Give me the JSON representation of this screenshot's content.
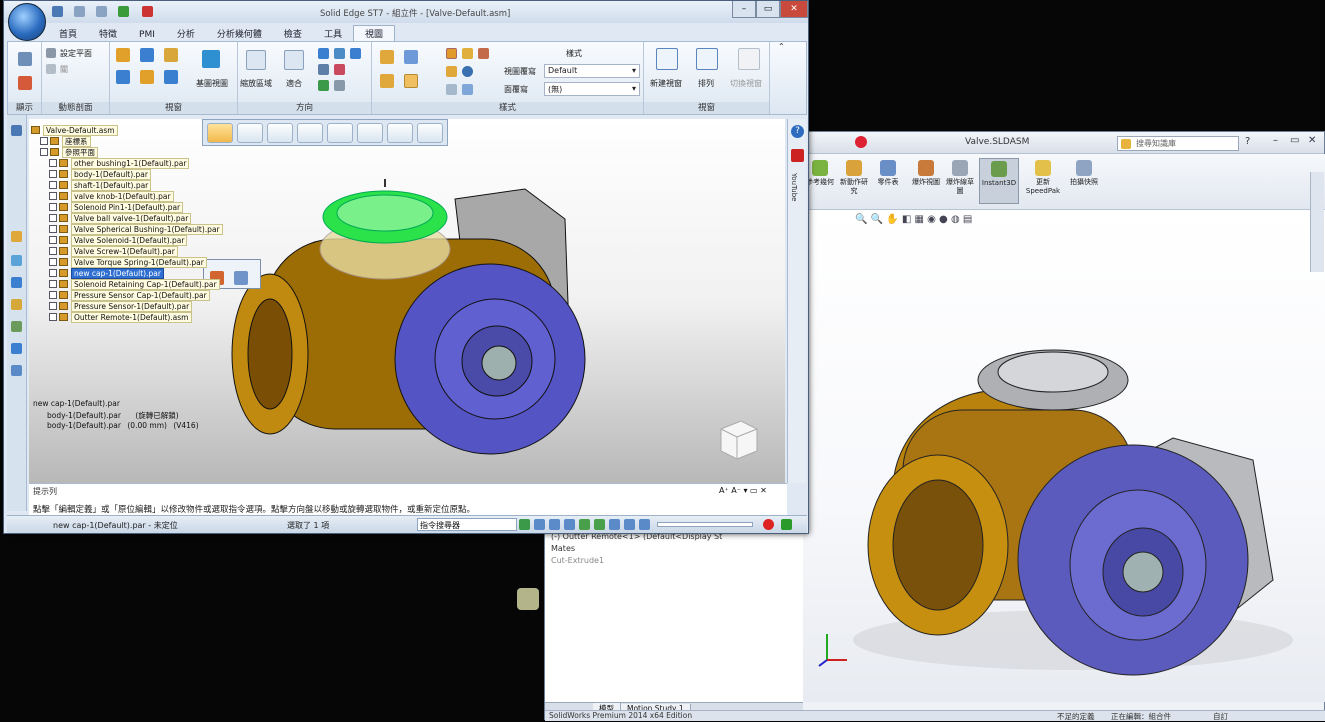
{
  "solidedge": {
    "title": "Solid Edge ST7 - 組立件 - [Valve-Default.asm]",
    "tabs": [
      "首頁",
      "特徵",
      "PMI",
      "分析",
      "分析幾何體",
      "檢查",
      "工具",
      "視圖"
    ],
    "active_tab": "視圖",
    "ribbon": {
      "show_label": "顯示",
      "dynamic_section_label": "動態剖面",
      "set_plane": "設定平面",
      "close": "關",
      "views_label": "視窗",
      "base_view": "基圖視圖",
      "zoom_area": "縮放區域",
      "fit": "適合",
      "orient_label": "方向",
      "view_style": "視圖覆寫",
      "surface_view": "面覆寫",
      "style": "樣式",
      "style_value": "Default",
      "style_none": "(無)",
      "style_group_label": "樣式",
      "new_window": "新建視窗",
      "arrange": "排列",
      "switch_window": "切換視窗",
      "window_group_label": "視窗"
    },
    "pathfinder": [
      {
        "label": "Valve-Default.asm",
        "indent": 0
      },
      {
        "label": "座標系",
        "indent": 1
      },
      {
        "label": "參照平面",
        "indent": 1
      },
      {
        "label": "other bushing1-1(Default).par",
        "indent": 2
      },
      {
        "label": "body-1(Default).par",
        "indent": 2
      },
      {
        "label": "shaft-1(Default).par",
        "indent": 2
      },
      {
        "label": "valve knob-1(Default).par",
        "indent": 2
      },
      {
        "label": "Solenoid Pin1-1(Default).par",
        "indent": 2
      },
      {
        "label": "Valve ball valve-1(Default).par",
        "indent": 2
      },
      {
        "label": "Valve Spherical Bushing-1(Default).par",
        "indent": 2
      },
      {
        "label": "Valve Solenoid-1(Default).par",
        "indent": 2
      },
      {
        "label": "Valve Screw-1(Default).par",
        "indent": 2
      },
      {
        "label": "Valve Torque Spring-1(Default).par",
        "indent": 2
      },
      {
        "label": "new cap-1(Default).par",
        "indent": 2,
        "selected": true
      },
      {
        "label": "Solenoid Retaining Cap-1(Default).par",
        "indent": 2
      },
      {
        "label": "Pressure Sensor Cap-1(Default).par",
        "indent": 2
      },
      {
        "label": "Pressure Sensor-1(Default).par",
        "indent": 2
      },
      {
        "label": "Outter Remote-1(Default).asm",
        "indent": 2
      }
    ],
    "relations": {
      "title": "new cap-1(Default).par",
      "r1": "body-1(Default).par",
      "r1_note": "(旋轉已解鎖)",
      "r2": "body-1(Default).par",
      "r2_value": "(0.00 mm)",
      "r2_version": "(V416)"
    },
    "hint_label": "提示列",
    "hint_text": "點擊「編輯定義」或「原位編輯」以修改物件或選取指令選項。點擊方向盤以移動或旋轉選取物件，或重新定位原點。",
    "status_doc": "new cap-1(Default).par - 未定位",
    "status_sel": "選取了 1 項",
    "command_finder": "指令搜尋器",
    "youtube": "YouTube"
  },
  "solidworks": {
    "title": "Valve.SLDASM",
    "search_placeholder": "搜尋知識庫",
    "ribbon": [
      "參考幾何",
      "新動作研究",
      "零件表",
      "爆炸視圖",
      "爆炸線草圖",
      "Instant3D",
      "更新SpeedPak",
      "拍攝快照"
    ],
    "tree": [
      "(-) Outter Remote<1> (Default<Display St",
      "Mates",
      "Cut-Extrude1"
    ],
    "tabs": [
      "模型",
      "Motion Study 1"
    ],
    "status_left": "SolidWorks Premium 2014 x64 Edition",
    "status_right": [
      "不足的定義",
      "正在編輯：組合件",
      "自訂"
    ]
  }
}
